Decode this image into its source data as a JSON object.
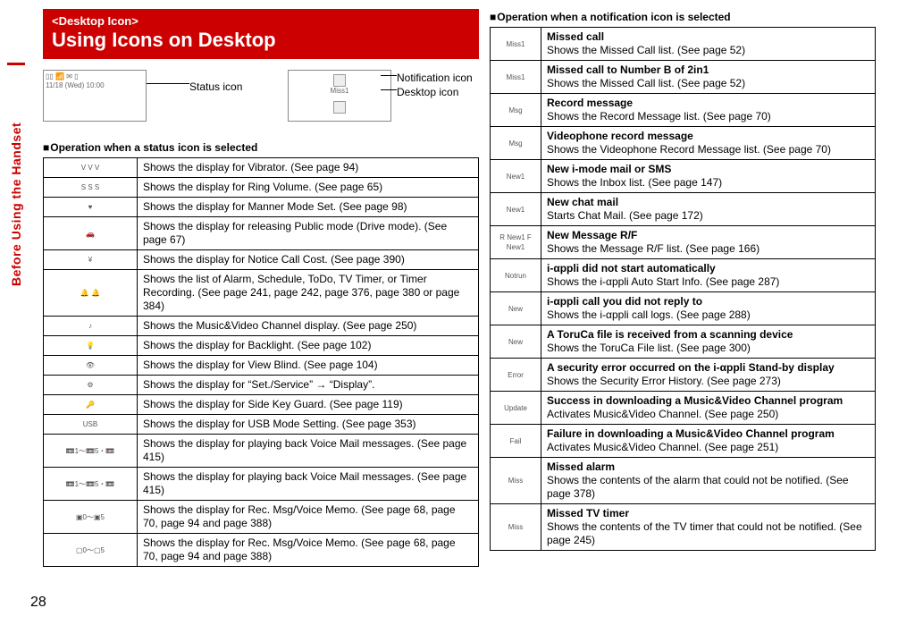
{
  "sideTab": "Before Using the Handset",
  "pageNumber": "28",
  "header": {
    "kicker": "<Desktop Icon>",
    "title": "Using Icons on Desktop"
  },
  "diagram": {
    "statusIcon": "Status icon",
    "notificationIcon": "Notification icon",
    "desktopIcon": "Desktop icon",
    "dateLine": "11/18 (Wed) 10:00",
    "missLabel": "Miss1"
  },
  "section1": {
    "title": "Operation when a status icon is selected",
    "rows": [
      {
        "icon": "V V V",
        "text": "Shows the display for Vibrator. (See page 94)"
      },
      {
        "icon": "S S S",
        "text": "Shows the display for Ring Volume. (See page 65)"
      },
      {
        "icon": "♥",
        "text": "Shows the display for Manner Mode Set. (See page 98)"
      },
      {
        "icon": "🚗",
        "text": "Shows the display for releasing Public mode (Drive mode). (See page 67)"
      },
      {
        "icon": "¥",
        "text": "Shows the display for Notice Call Cost. (See page 390)"
      },
      {
        "icon": "🔔 🔔",
        "text": "Shows the list of Alarm, Schedule, ToDo, TV Timer, or Timer Recording. (See page 241, page 242, page 376, page 380 or page 384)"
      },
      {
        "icon": "♪",
        "text": "Shows the Music&Video Channel display. (See page 250)"
      },
      {
        "icon": "💡",
        "text": "Shows the display for Backlight. (See page 102)"
      },
      {
        "icon": "👁",
        "text": "Shows the display for View Blind. (See page 104)"
      },
      {
        "icon": "⚙",
        "text": "Shows the display for “Set./Service” → “Display”."
      },
      {
        "icon": "🔑",
        "text": "Shows the display for Side Key Guard. (See page 119)"
      },
      {
        "icon": "USB",
        "text": "Shows the display for USB Mode Setting. (See page 353)"
      },
      {
        "icon": "📼1～📼5・📼",
        "text": "Shows the display for playing back Voice Mail messages. (See page 415)"
      },
      {
        "icon": "📼1～📼5・📼",
        "text": "Shows the display for playing back Voice Mail messages. (See page 415)"
      },
      {
        "icon": "▣0～▣5",
        "text": "Shows the display for Rec. Msg/Voice Memo. (See page 68, page 70, page 94 and page 388)"
      },
      {
        "icon": "▢0～▢5",
        "text": "Shows the display for Rec. Msg/Voice Memo. (See page 68, page 70, page 94 and page 388)"
      }
    ]
  },
  "section2": {
    "title": "Operation when a notification icon is selected",
    "rows": [
      {
        "icon": "Miss1",
        "bold": "Missed call",
        "text": "Shows the Missed Call list. (See page 52)"
      },
      {
        "icon": "Miss1",
        "bold": "Missed call to Number B of 2in1",
        "text": "Shows the Missed Call list. (See page 52)"
      },
      {
        "icon": "Msg",
        "bold": "Record message",
        "text": "Shows the Record Message list. (See page 70)"
      },
      {
        "icon": "Msg",
        "bold": "Videophone record message",
        "text": "Shows the Videophone Record Message list. (See page 70)"
      },
      {
        "icon": "New1",
        "bold": "New i-mode mail or SMS",
        "text": "Shows the Inbox list. (See page 147)"
      },
      {
        "icon": "New1",
        "bold": "New chat mail",
        "text": "Starts Chat Mail. (See page 172)"
      },
      {
        "icon": "R New1 F New1",
        "bold": "New Message R/F",
        "text": "Shows the Message R/F list. (See page 166)"
      },
      {
        "icon": "Notrun",
        "bold": "i-αppli did not start automatically",
        "text": "Shows the i-αppli Auto Start Info. (See page 287)"
      },
      {
        "icon": "New",
        "bold": "i-αppli call you did not reply to",
        "text": "Shows the i-αppli call logs. (See page 288)"
      },
      {
        "icon": "New",
        "bold": "A ToruCa file is received from a scanning device",
        "text": "Shows the ToruCa File list. (See page 300)"
      },
      {
        "icon": "Error",
        "bold": "A security error occurred on the i-αppli Stand-by display",
        "text": "Shows the Security Error History. (See page 273)"
      },
      {
        "icon": "Update",
        "bold": "Success in downloading a Music&Video Channel program",
        "text": "Activates Music&Video Channel. (See page 250)"
      },
      {
        "icon": "Fail",
        "bold": "Failure in downloading a Music&Video Channel program",
        "text": "Activates Music&Video Channel. (See page 251)"
      },
      {
        "icon": "Miss",
        "bold": "Missed alarm",
        "text": "Shows the contents of the alarm that could not be notified. (See page 378)"
      },
      {
        "icon": "Miss",
        "bold": "Missed TV timer",
        "text": "Shows the contents of the TV timer that could not be notified. (See page 245)"
      }
    ]
  }
}
